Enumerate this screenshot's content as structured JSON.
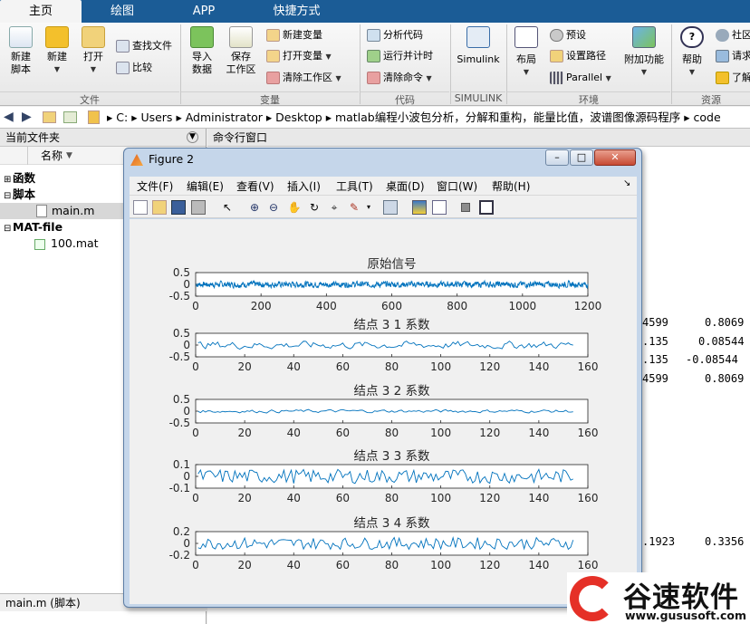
{
  "tabs": [
    "主页",
    "绘图",
    "APP",
    "快捷方式"
  ],
  "ribbon": {
    "file": {
      "new_script": "新建\n脚本",
      "new": "新建",
      "open": "打开",
      "find_files": "查找文件",
      "compare": "比较",
      "group": "文件"
    },
    "variable": {
      "import": "导入\n数据",
      "save_ws": "保存\n工作区",
      "new_var": "新建变量",
      "open_var": "打开变量",
      "clear_ws": "清除工作区",
      "group": "变量"
    },
    "code": {
      "analyze": "分析代码",
      "run_time": "运行并计时",
      "clear_cmd": "清除命令",
      "group": "代码"
    },
    "simulink": {
      "label": "Simulink",
      "group": "SIMULINK"
    },
    "env": {
      "layout": "布局",
      "prefs": "预设",
      "set_path": "设置路径",
      "parallel": "Parallel",
      "addons": "附加功能",
      "group": "环境"
    },
    "resources": {
      "help": "帮助",
      "community": "社区",
      "request": "请求",
      "learn": "了解",
      "group": "资源"
    }
  },
  "address": {
    "segments": [
      "C:",
      "Users",
      "Administrator",
      "Desktop",
      "matlab编程小波包分析，分解和重构，能量比值，波谱图像源码程序",
      "code"
    ]
  },
  "current_folder": {
    "title": "当前文件夹",
    "col_name": "名称",
    "items": [
      {
        "label": "函数"
      },
      {
        "label": "脚本"
      },
      {
        "label": "main.m"
      },
      {
        "label": "MAT-file"
      },
      {
        "label": "100.mat"
      }
    ],
    "status": "main.m  (脚本)"
  },
  "command_window": {
    "title": "命令行窗口",
    "rows": [
      [
        "4599",
        "0.8069"
      ],
      [
        ".135",
        "0.08544"
      ],
      [
        ".135",
        "-0.08544"
      ],
      [
        "4599",
        "0.8069"
      ],
      [
        ".1923",
        "0.3356"
      ]
    ]
  },
  "figure": {
    "title": "Figure 2",
    "menu": [
      "文件(F)",
      "编辑(E)",
      "查看(V)",
      "插入(I)",
      "工具(T)",
      "桌面(D)",
      "窗口(W)",
      "帮助(H)"
    ],
    "window_buttons": [
      "–",
      "□",
      "✕"
    ]
  },
  "chart_data": [
    {
      "type": "line",
      "title": "原始信号",
      "xlim": [
        0,
        1200
      ],
      "ylim": [
        -0.5,
        0.5
      ],
      "xticks": [
        0,
        200,
        400,
        600,
        800,
        1000,
        1200
      ],
      "yticks": [
        0.5,
        0,
        -0.5
      ],
      "n": 1200,
      "amp": 0.13,
      "color": "#0072bd"
    },
    {
      "type": "line",
      "title": "结点 3  1 系数",
      "xlim": [
        0,
        160
      ],
      "ylim": [
        -0.5,
        0.5
      ],
      "xticks": [
        0,
        20,
        40,
        60,
        80,
        100,
        120,
        140,
        160
      ],
      "yticks": [
        0.5,
        0,
        -0.5
      ],
      "n": 154,
      "amp": 0.17,
      "color": "#0072bd"
    },
    {
      "type": "line",
      "title": "结点 3  2 系数",
      "xlim": [
        0,
        160
      ],
      "ylim": [
        -0.5,
        0.5
      ],
      "xticks": [
        0,
        20,
        40,
        60,
        80,
        100,
        120,
        140,
        160
      ],
      "yticks": [
        0.5,
        0,
        -0.5
      ],
      "n": 154,
      "amp": 0.07,
      "color": "#0072bd"
    },
    {
      "type": "line",
      "title": "结点 3  3 系数",
      "xlim": [
        0,
        160
      ],
      "ylim": [
        -0.1,
        0.1
      ],
      "xticks": [
        0,
        20,
        40,
        60,
        80,
        100,
        120,
        140,
        160
      ],
      "yticks": [
        0.1,
        0,
        -0.1
      ],
      "n": 154,
      "amp": 0.06,
      "color": "#0072bd"
    },
    {
      "type": "line",
      "title": "结点 3  4 系数",
      "xlim": [
        0,
        160
      ],
      "ylim": [
        -0.2,
        0.2
      ],
      "xticks": [
        0,
        20,
        40,
        60,
        80,
        100,
        120,
        140,
        160
      ],
      "yticks": [
        0.2,
        0,
        -0.2
      ],
      "n": 154,
      "amp": 0.1,
      "color": "#0072bd"
    }
  ],
  "watermark": {
    "brand": "谷速软件",
    "url": "www.gususoft.com"
  }
}
